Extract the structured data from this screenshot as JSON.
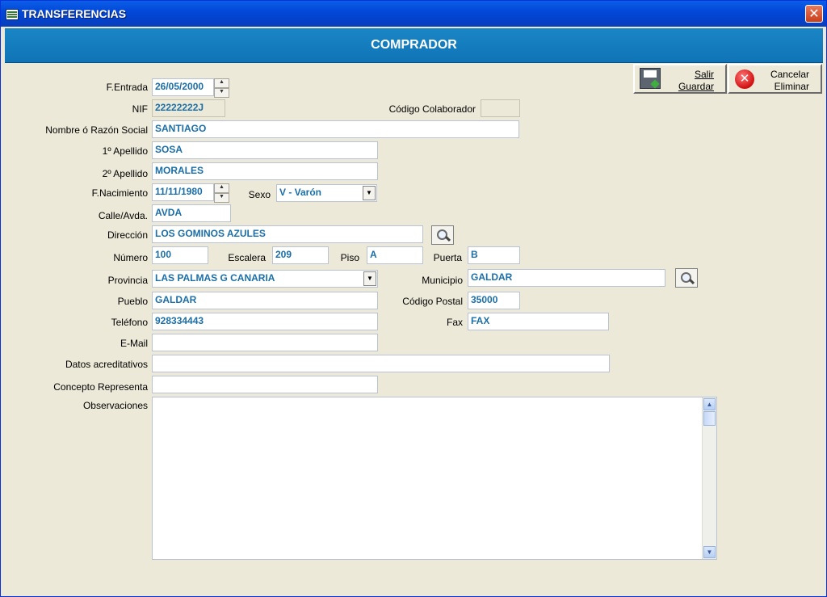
{
  "window": {
    "title": "TRANSFERENCIAS"
  },
  "header": {
    "title": "COMPRADOR"
  },
  "actions": {
    "save": {
      "line1": "Salir",
      "line2": "Guardar"
    },
    "cancel": {
      "line1": "Cancelar",
      "line2": "Eliminar"
    }
  },
  "form": {
    "fecha_entrada": {
      "label": "F.Entrada",
      "value": "26/05/2000"
    },
    "nif": {
      "label": "NIF",
      "value": "22222222J"
    },
    "codigo_colaborador": {
      "label": "Código Colaborador",
      "value": ""
    },
    "nombre": {
      "label": "Nombre ó Razón Social",
      "value": "SANTIAGO"
    },
    "apellido1": {
      "label": "1º Apellido",
      "value": "SOSA"
    },
    "apellido2": {
      "label": "2º Apellido",
      "value": "MORALES"
    },
    "fecha_nacimiento": {
      "label": "F.Nacimiento",
      "value": "11/11/1980"
    },
    "sexo": {
      "label": "Sexo",
      "value": "V - Varón"
    },
    "calle": {
      "label": "Calle/Avda.",
      "value": "AVDA"
    },
    "direccion": {
      "label": "Dirección",
      "value": "LOS GOMINOS AZULES"
    },
    "numero": {
      "label": "Número",
      "value": "100"
    },
    "escalera": {
      "label": "Escalera",
      "value": "209"
    },
    "piso": {
      "label": "Piso",
      "value": "A"
    },
    "puerta": {
      "label": "Puerta",
      "value": "B"
    },
    "provincia": {
      "label": "Provincia",
      "value": "LAS PALMAS G CANARIA"
    },
    "municipio": {
      "label": "Municipio",
      "value": "GALDAR"
    },
    "pueblo": {
      "label": "Pueblo",
      "value": "GALDAR"
    },
    "codigo_postal": {
      "label": "Código Postal",
      "value": "35000"
    },
    "telefono": {
      "label": "Teléfono",
      "value": "928334443"
    },
    "fax": {
      "label": "Fax",
      "value": "FAX"
    },
    "email": {
      "label": "E-Mail",
      "value": ""
    },
    "datos_acreditativos": {
      "label": "Datos acreditativos",
      "value": ""
    },
    "concepto_representa": {
      "label": "Concepto Representa",
      "value": ""
    },
    "observaciones": {
      "label": "Observaciones",
      "value": ""
    }
  }
}
